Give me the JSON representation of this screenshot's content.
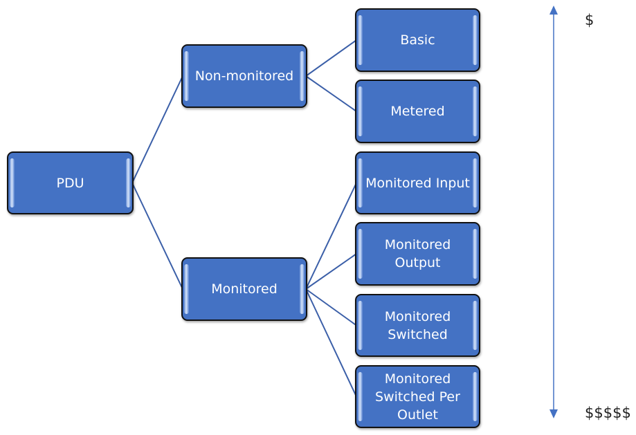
{
  "diagram": {
    "root": {
      "id": "pdu",
      "label": "PDU"
    },
    "level1": [
      {
        "id": "non-monitored",
        "label": "Non-monitored",
        "parent": "pdu"
      },
      {
        "id": "monitored",
        "label": "Monitored",
        "parent": "pdu"
      }
    ],
    "level2": [
      {
        "id": "basic",
        "label": "Basic",
        "parent": "non-monitored"
      },
      {
        "id": "metered",
        "label": "Metered",
        "parent": "non-monitored"
      },
      {
        "id": "monitored-input",
        "label": "Monitored Input",
        "parent": "monitored"
      },
      {
        "id": "monitored-output",
        "label": "Monitored\nOutput",
        "parent": "monitored"
      },
      {
        "id": "monitored-switched",
        "label": "Monitored\nSwitched",
        "parent": "monitored"
      },
      {
        "id": "monitored-switched-per-outlet",
        "label": "Monitored\nSwitched Per\nOutlet",
        "parent": "monitored"
      }
    ],
    "cost_axis": {
      "low_label": "$",
      "high_label": "$$$$$",
      "direction": "bidirectional"
    },
    "colors": {
      "node_fill": "#4472c4",
      "node_border": "#111111",
      "connector": "#3b5fa8",
      "axis_arrow": "#4472c4",
      "node_text": "#ffffff"
    }
  }
}
